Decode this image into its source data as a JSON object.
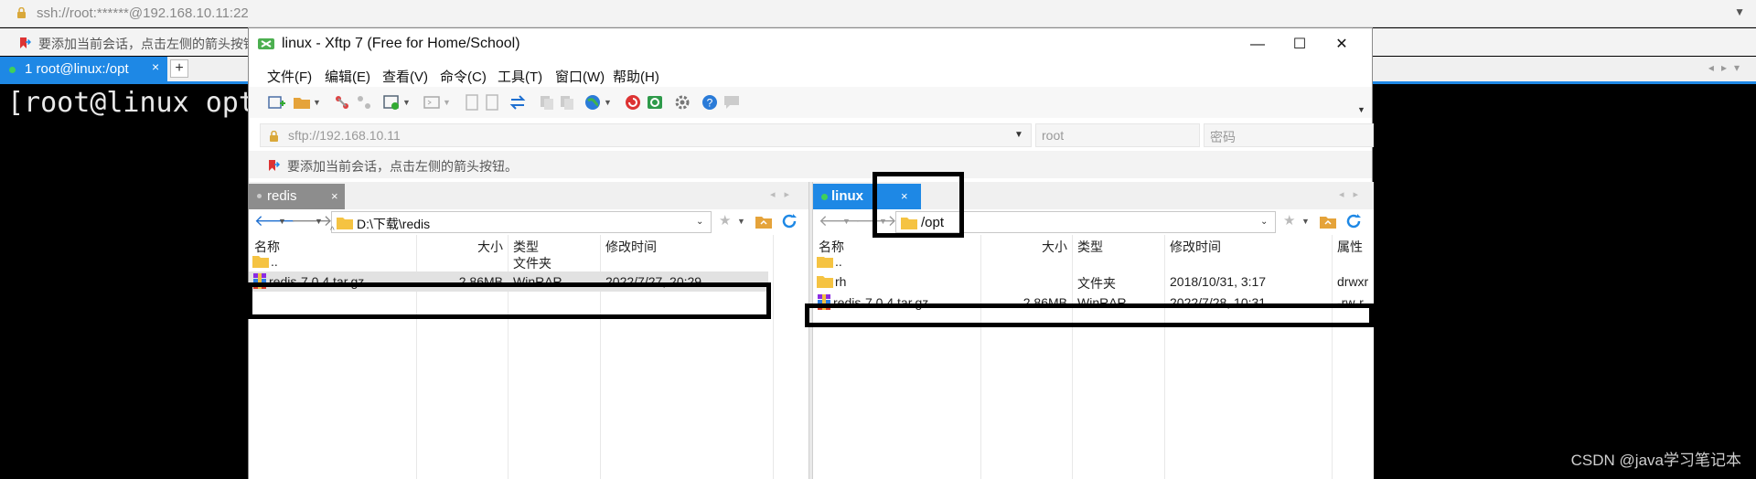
{
  "background": {
    "address": "ssh://root:******@192.168.10.11:22",
    "hint": "要添加当前会话，点击左侧的箭头按钮。",
    "tab_label": "1 root@linux:/opt",
    "tab_close": "×",
    "tab_add": "+",
    "terminal_text": "[root@linux opt",
    "watermark": "CSDN @java学习笔记本"
  },
  "window": {
    "title": "linux - Xftp 7 (Free for Home/School)",
    "minimize": "—",
    "maximize": "☐",
    "close": "✕"
  },
  "menu": [
    "文件(F)",
    "编辑(E)",
    "查看(V)",
    "命令(C)",
    "工具(T)",
    "窗口(W)",
    "帮助(H)"
  ],
  "address_bar": {
    "url": "sftp://192.168.10.11",
    "user_placeholder": "root",
    "password_placeholder": "密码"
  },
  "hint": "要添加当前会话，点击左侧的箭头按钮。",
  "local": {
    "tab": "redis",
    "tab_close": "×",
    "path": "D:\\下载\\redis",
    "columns": [
      "名称",
      "大小",
      "类型",
      "修改时间"
    ],
    "rows": [
      {
        "name": "..",
        "size": "",
        "type": "文件夹",
        "modified": ""
      },
      {
        "name": "redis-7.0.4.tar.gz",
        "size": "2.86MB",
        "type": "WinRAR ...",
        "modified": "2022/7/27, 20:29"
      }
    ]
  },
  "remote": {
    "tab": "linux",
    "tab_close": "×",
    "path": "/opt",
    "columns": [
      "名称",
      "大小",
      "类型",
      "修改时间",
      "属性"
    ],
    "rows": [
      {
        "name": "..",
        "size": "",
        "type": "",
        "modified": "",
        "attr": ""
      },
      {
        "name": "rh",
        "size": "",
        "type": "文件夹",
        "modified": "2018/10/31, 3:17",
        "attr": "drwxr"
      },
      {
        "name": "redis-7.0.4.tar.gz",
        "size": "2.86MB",
        "type": "WinRAR ...",
        "modified": "2022/7/28, 10:31",
        "attr": "-rw-r"
      }
    ]
  },
  "colors": {
    "accent": "#1e88e5",
    "online_dot": "#3fd05a",
    "folder": "#f5c342",
    "annotation": "#000000"
  }
}
